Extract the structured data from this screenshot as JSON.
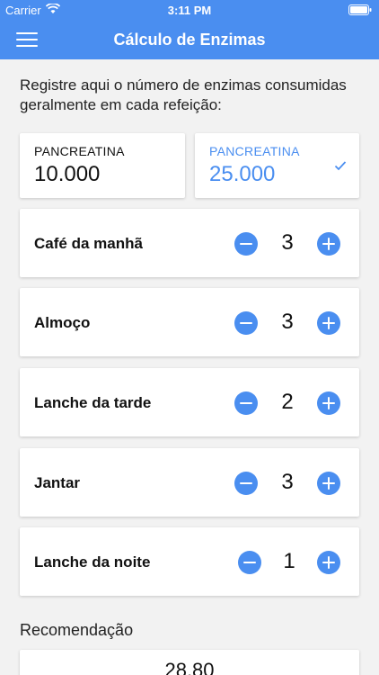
{
  "status": {
    "carrier": "Carrier",
    "time": "3:11 PM"
  },
  "nav": {
    "title": "Cálculo de Enzimas"
  },
  "intro": "Registre aqui o número de enzimas consumidas geralmente em cada refeição:",
  "enzymes": [
    {
      "label": "PANCREATINA",
      "value": "10.000",
      "selected": false
    },
    {
      "label": "PANCREATINA",
      "value": "25.000",
      "selected": true
    }
  ],
  "meals": [
    {
      "name": "Café da manhã",
      "qty": "3"
    },
    {
      "name": "Almoço",
      "qty": "3"
    },
    {
      "name": "Lanche da tarde",
      "qty": "2"
    },
    {
      "name": "Jantar",
      "qty": "3"
    },
    {
      "name": "Lanche da noite",
      "qty": "1"
    }
  ],
  "recommendation": {
    "title": "Recomendação",
    "value": "28,80"
  },
  "colors": {
    "accent": "#4a8ef0",
    "background": "#f2f2f2",
    "card": "#ffffff"
  },
  "icons": [
    "wifi-icon",
    "battery-icon",
    "menu-icon",
    "check-icon",
    "minus-icon",
    "plus-icon"
  ]
}
